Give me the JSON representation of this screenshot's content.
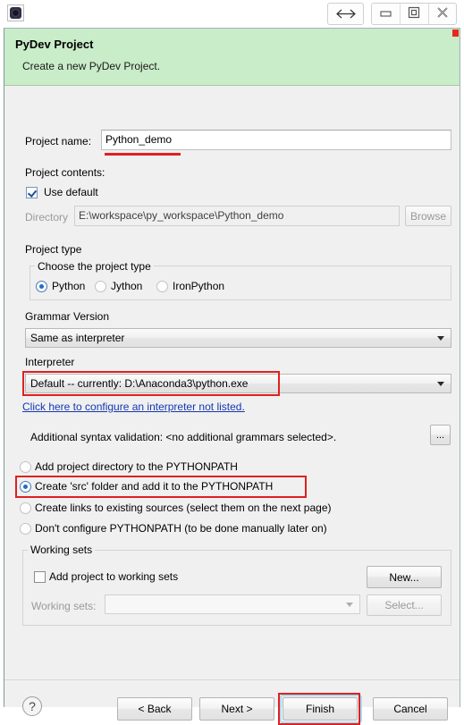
{
  "titlebar": {
    "app_icon": "pydev-gear-icon",
    "resize_button_icon": "left-right-arrows-icon",
    "minimize_icon": "minimize-icon",
    "restore_icon": "restore-icon",
    "close_icon": "close-icon"
  },
  "banner": {
    "title": "PyDev Project",
    "subtitle": "Create a new PyDev Project.",
    "accent_color": "#c9ecc9",
    "marker_color": "#e8281e"
  },
  "form": {
    "project_name_label": "Project name:",
    "project_name_value": "Python_demo",
    "project_contents_label": "Project contents:",
    "use_default_label": "Use default",
    "use_default_checked": true,
    "directory_label": "Directory",
    "directory_value": "E:\\workspace\\py_workspace\\Python_demo",
    "browse_label": "Browse"
  },
  "project_type": {
    "section_label": "Project type",
    "group_label": "Choose the project type",
    "options": [
      {
        "label": "Python",
        "selected": true
      },
      {
        "label": "Jython",
        "selected": false
      },
      {
        "label": "IronPython",
        "selected": false
      }
    ]
  },
  "grammar": {
    "label": "Grammar Version",
    "value": "Same as interpreter"
  },
  "interpreter": {
    "label": "Interpreter",
    "value": "Default  --  currently: D:\\Anaconda3\\python.exe",
    "link": "Click here to configure an interpreter not listed.",
    "syntax_validation_label": "Additional syntax validation: <no additional grammars selected>.",
    "ellipsis_button": "..."
  },
  "pythonpath": {
    "options": [
      {
        "label": "Add project directory to the PYTHONPATH",
        "selected": false
      },
      {
        "label": "Create 'src' folder and add it to the PYTHONPATH",
        "selected": true
      },
      {
        "label": "Create links to existing sources (select them on the next page)",
        "selected": false
      },
      {
        "label": "Don't configure PYTHONPATH (to be done manually later on)",
        "selected": false
      }
    ]
  },
  "working_sets": {
    "group_label": "Working sets",
    "add_label": "Add project to working sets",
    "add_checked": false,
    "new_label": "New...",
    "sets_label": "Working sets:",
    "sets_value": "",
    "select_label": "Select..."
  },
  "footer": {
    "help_icon": "?",
    "back_label": "< Back",
    "next_label": "Next >",
    "finish_label": "Finish",
    "cancel_label": "Cancel"
  },
  "annotations": {
    "highlight_color": "#e02020",
    "targets": [
      "project-name-value",
      "interpreter-combo",
      "pythonpath-option-1",
      "finish-button"
    ]
  }
}
